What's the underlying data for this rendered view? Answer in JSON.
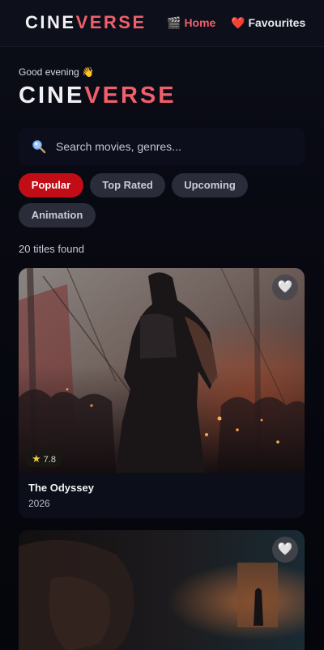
{
  "header": {
    "logo_part1": "CINE",
    "logo_part2": "VERSE",
    "nav": [
      {
        "label": "Home",
        "icon": "🎬",
        "active": true
      },
      {
        "label": "Favourites",
        "icon": "❤️",
        "active": false
      }
    ]
  },
  "hero": {
    "greeting": "Good evening 👋",
    "title_part1": "CINE",
    "title_part2": "VERSE"
  },
  "search": {
    "placeholder": "Search movies, genres...",
    "value": "",
    "icon": "search-icon"
  },
  "filters": [
    {
      "label": "Popular",
      "active": true
    },
    {
      "label": "Top Rated",
      "active": false
    },
    {
      "label": "Upcoming",
      "active": false
    },
    {
      "label": "Animation",
      "active": false
    }
  ],
  "results": {
    "count_text": "20 titles found"
  },
  "movies": [
    {
      "title": "The Odyssey",
      "year": "2026",
      "rating": "7.8",
      "favourite_icon": "heart-icon"
    },
    {
      "title": "",
      "year": "",
      "rating": "",
      "favourite_icon": "heart-icon"
    }
  ],
  "colors": {
    "accent": "#f0606b",
    "chip_active": "#c00d16",
    "chip_idle": "#2a2c3a",
    "background": "#05060c",
    "rating_star": "#f5c842"
  }
}
